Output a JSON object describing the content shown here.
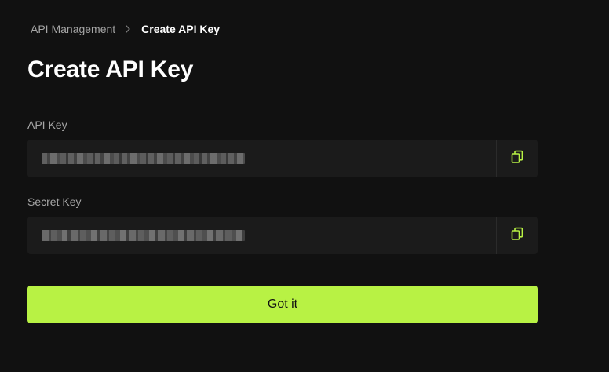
{
  "breadcrumb": {
    "parent": "API Management",
    "current": "Create API Key"
  },
  "page": {
    "title": "Create API Key"
  },
  "api_key": {
    "label": "API Key",
    "value": "••••••••••••••••••••••••••••••••••••"
  },
  "secret_key": {
    "label": "Secret Key",
    "value": "••••••••••••••••••••••••••••••••••••"
  },
  "actions": {
    "confirm_label": "Got it"
  },
  "colors": {
    "accent": "#b8f244",
    "background": "#111111",
    "field_background": "#1b1b1b"
  },
  "icons": {
    "breadcrumb_separator": "chevron-right-icon",
    "copy": "copy-icon"
  }
}
